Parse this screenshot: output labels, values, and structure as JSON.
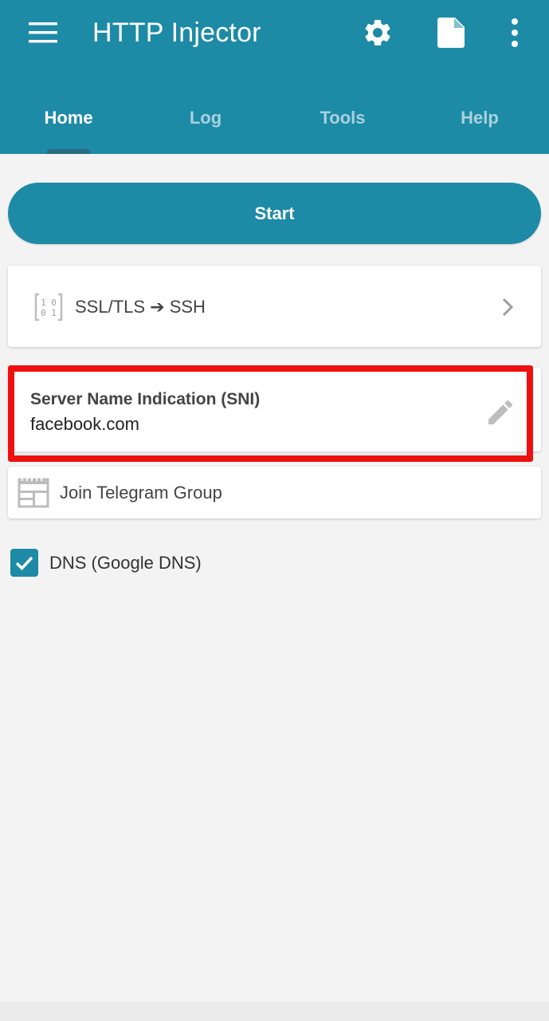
{
  "colors": {
    "primary": "#1d8aa6",
    "tab_indicator": "#2a6c80",
    "background": "#f3f3f3",
    "highlight": "#ee0f0f",
    "icon_gray": "#bdbdbd"
  },
  "toolbar": {
    "title": "HTTP Injector",
    "icons": [
      "menu-icon",
      "gear-icon",
      "file-icon",
      "more-vert-icon"
    ]
  },
  "tabs": [
    {
      "label": "Home",
      "active": true
    },
    {
      "label": "Log",
      "active": false
    },
    {
      "label": "Tools",
      "active": false
    },
    {
      "label": "Help",
      "active": false
    }
  ],
  "start_button": {
    "label": "Start"
  },
  "tunnel": {
    "icon": "binary-icon",
    "label": "SSL/TLS ➔ SSH",
    "trailing_icon": "chevron-right-icon"
  },
  "sni": {
    "title": "Server Name Indication (SNI)",
    "value": "facebook.com",
    "trailing_icon": "pencil-icon"
  },
  "telegram": {
    "icon": "telegram-group-icon",
    "label": "Join Telegram Group"
  },
  "dns": {
    "checked": true,
    "label": "DNS (Google DNS)"
  }
}
